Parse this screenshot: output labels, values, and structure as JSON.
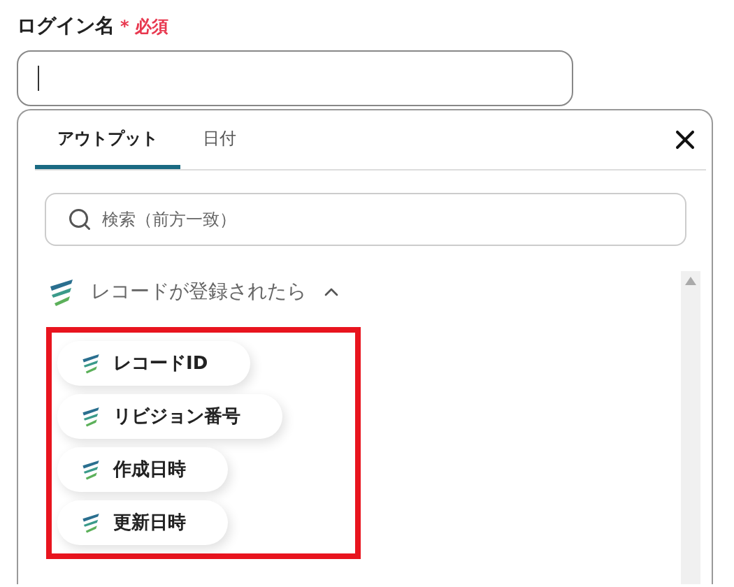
{
  "field": {
    "label": "ログイン名",
    "required_mark": "*",
    "required_text": "必須"
  },
  "panel": {
    "tabs": [
      {
        "label": "アウトプット",
        "selected": true
      },
      {
        "label": "日付",
        "selected": false
      }
    ],
    "search": {
      "placeholder": "検索（前方一致）"
    },
    "section": {
      "title": "レコードが登録されたら",
      "expanded": true,
      "items": [
        {
          "label": "レコードID"
        },
        {
          "label": "リビジョン番号"
        },
        {
          "label": "作成日時"
        },
        {
          "label": "更新日時"
        }
      ]
    }
  }
}
